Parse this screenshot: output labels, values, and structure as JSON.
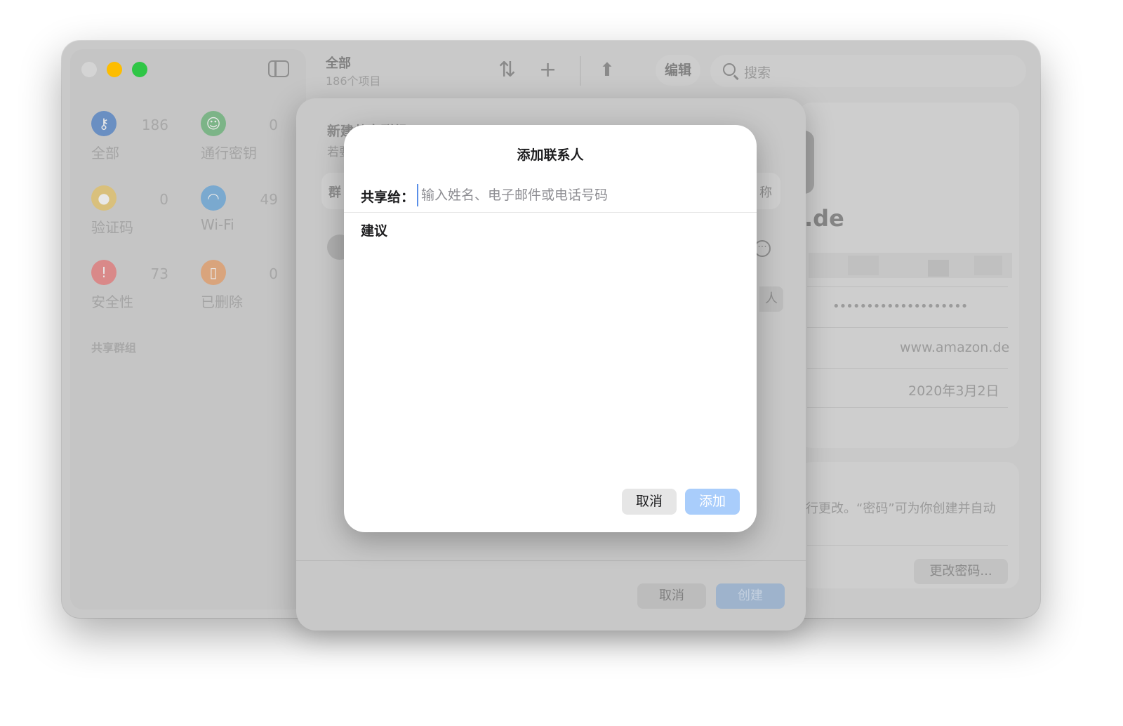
{
  "colors": {
    "close_disabled": "#d4d4d4",
    "minimize": "#fdbd00",
    "maximize": "#2fc646",
    "accent_disabled": "#a9cdfb"
  },
  "sidebar": {
    "categories": [
      {
        "label": "全部",
        "count": "186",
        "icon": "key-icon",
        "color": "#6a8fc2"
      },
      {
        "label": "通行密钥",
        "count": "0",
        "icon": "passkey-icon",
        "color": "#7cb487"
      },
      {
        "label": "验证码",
        "count": "0",
        "icon": "lock-icon",
        "color": "#d9c07c"
      },
      {
        "label": "Wi-Fi",
        "count": "49",
        "icon": "wifi-icon",
        "color": "#7aa9cf"
      },
      {
        "label": "安全性",
        "count": "73",
        "icon": "alert-icon",
        "color": "#d98989"
      },
      {
        "label": "已删除",
        "count": "0",
        "icon": "trash-icon",
        "color": "#d9a47c"
      }
    ],
    "section_title": "共享群组"
  },
  "toolbar": {
    "title": "全部",
    "subtitle": "186个项目",
    "sort_icon": "⇅",
    "add_icon": "+",
    "share_icon": "⬆",
    "edit_label": "编辑",
    "search_placeholder": "搜索"
  },
  "detail": {
    "domain_suffix": ".de",
    "password_mask": "••••••••••••••••••••",
    "website": "www.amazon.de",
    "date": "2020年3月2日",
    "note": "行更改。“密码”可为你创建并自动",
    "change_password_label": "更改密码..."
  },
  "sheet": {
    "title": "新建共享群组",
    "subtitle": "若要",
    "group_label": "群",
    "name_suffix": "称",
    "people_suffix": "人",
    "more_icon": "···",
    "cancel_label": "取消",
    "create_label": "创建"
  },
  "dialog": {
    "title": "添加联系人",
    "share_label": "共享给：",
    "input_placeholder": "输入姓名、电子邮件或电话号码",
    "suggestions_label": "建议",
    "cancel_label": "取消",
    "add_label": "添加"
  }
}
